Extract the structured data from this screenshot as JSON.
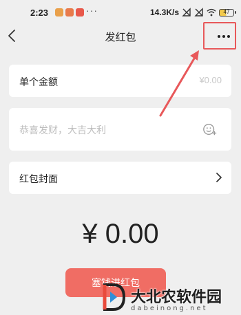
{
  "status_bar": {
    "time": "2:23",
    "dots": "···",
    "network_speed": "14.3K/s",
    "battery_level": "47"
  },
  "nav": {
    "title": "发红包",
    "back_icon": "chevron-left-icon",
    "more_icon": "more-horizontal-icon"
  },
  "form": {
    "amount_label": "单个金额",
    "amount_placeholder": "¥0.00",
    "greeting_placeholder": "恭喜发财，大吉大利",
    "emoji_icon": "emoji-add-icon",
    "cover_label": "红包封面",
    "cover_icon": "chevron-right-icon"
  },
  "total": {
    "amount": "¥ 0.00"
  },
  "send_button": {
    "label": "塞钱进红包"
  },
  "watermark": {
    "title": "大北农软件园",
    "subtitle": "dabeinong.net"
  },
  "colors": {
    "accent_red": "#f06d64",
    "annotation_red": "#e8585a",
    "background": "#efefef"
  }
}
